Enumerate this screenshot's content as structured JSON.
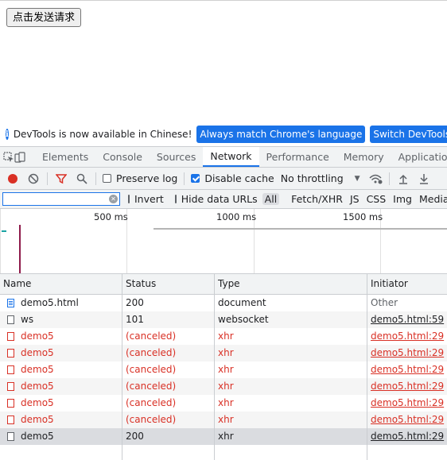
{
  "page": {
    "button_label": "点击发送请求"
  },
  "infobar": {
    "message": "DevTools is now available in Chinese!",
    "button1": "Always match Chrome's language",
    "button2": "Switch DevTools to Chinese"
  },
  "tabs": [
    "Elements",
    "Console",
    "Sources",
    "Network",
    "Performance",
    "Memory",
    "Application"
  ],
  "active_tab": "Network",
  "toolbar": {
    "preserve_log": "Preserve log",
    "disable_cache": "Disable cache",
    "throttling": "No throttling"
  },
  "filter": {
    "value": "",
    "invert": "Invert",
    "hide_data_urls": "Hide data URLs",
    "types": [
      "All",
      "Fetch/XHR",
      "JS",
      "CSS",
      "Img",
      "Media"
    ]
  },
  "overview": {
    "ticks": [
      "500 ms",
      "1000 ms",
      "1500 ms"
    ]
  },
  "table": {
    "columns": [
      "Name",
      "Status",
      "Type",
      "Initiator"
    ],
    "rows": [
      {
        "name": "demo5.html",
        "status": "200",
        "type": "document",
        "initiator": "Other"
      },
      {
        "name": "ws",
        "status": "101",
        "type": "websocket",
        "initiator": "demo5.html:59"
      },
      {
        "name": "demo5",
        "status": "(canceled)",
        "type": "xhr",
        "initiator": "demo5.html:29"
      },
      {
        "name": "demo5",
        "status": "(canceled)",
        "type": "xhr",
        "initiator": "demo5.html:29"
      },
      {
        "name": "demo5",
        "status": "(canceled)",
        "type": "xhr",
        "initiator": "demo5.html:29"
      },
      {
        "name": "demo5",
        "status": "(canceled)",
        "type": "xhr",
        "initiator": "demo5.html:29"
      },
      {
        "name": "demo5",
        "status": "(canceled)",
        "type": "xhr",
        "initiator": "demo5.html:29"
      },
      {
        "name": "demo5",
        "status": "(canceled)",
        "type": "xhr",
        "initiator": "demo5.html:29"
      },
      {
        "name": "demo5",
        "status": "200",
        "type": "xhr",
        "initiator": "demo5.html:29"
      }
    ]
  },
  "colors": {
    "accent": "#1a73e8",
    "error": "#d93025",
    "record": "#d93025"
  }
}
